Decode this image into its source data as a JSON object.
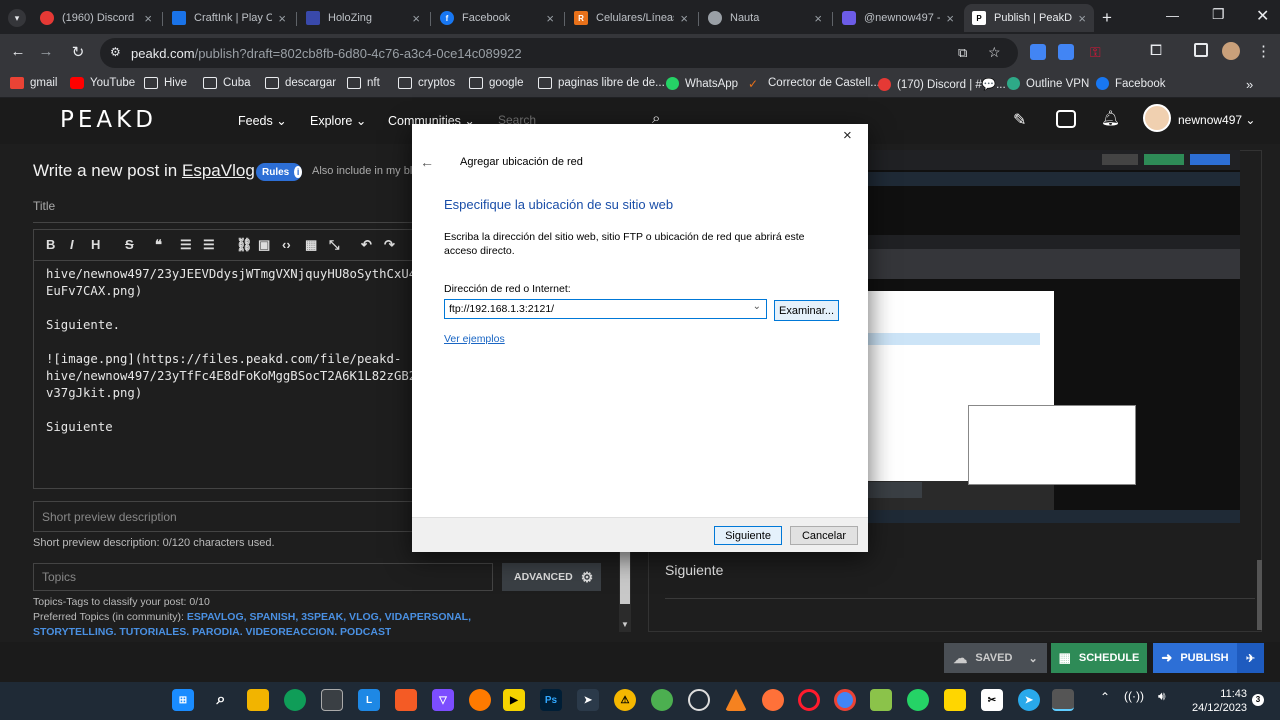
{
  "browser": {
    "tabs": [
      {
        "title": "(1960) Discord |",
        "icon": "discord-icon",
        "color": "#e53935",
        "badge": "1k+"
      },
      {
        "title": "CraftInk | Play Cr",
        "icon": "craftink-icon",
        "color": "#1a73e8"
      },
      {
        "title": "HoloZing",
        "icon": "holozing-icon",
        "color": "#3949ab"
      },
      {
        "title": "Facebook",
        "icon": "facebook-icon",
        "color": "#1877f2"
      },
      {
        "title": "Celulares/Líneas",
        "icon": "store-icon",
        "color": "#e8711a"
      },
      {
        "title": "Nauta",
        "icon": "globe-icon",
        "color": "#9aa0a6"
      },
      {
        "title": "@newnow497 -",
        "icon": "shield-icon",
        "color": "#6c5ce7"
      },
      {
        "title": "Publish | PeakD",
        "icon": "peakd-icon",
        "color": "#ffffff"
      }
    ],
    "url_main": "peakd.com",
    "url_rest": "/publish?draft=802cb8fb-6d80-4c76-a3c4-0ce14c089922",
    "bookmarks": [
      {
        "label": "gmail",
        "icon": "gmail-icon"
      },
      {
        "label": "YouTube",
        "icon": "youtube-icon"
      },
      {
        "label": "Hive",
        "icon": "folder-icon"
      },
      {
        "label": "Cuba",
        "icon": "folder-icon"
      },
      {
        "label": "descargar",
        "icon": "folder-icon"
      },
      {
        "label": "nft",
        "icon": "folder-icon"
      },
      {
        "label": "cryptos",
        "icon": "folder-icon"
      },
      {
        "label": "google",
        "icon": "folder-icon"
      },
      {
        "label": "paginas libre de de...",
        "icon": "folder-icon"
      },
      {
        "label": "WhatsApp",
        "icon": "whatsapp-icon"
      },
      {
        "label": "Corrector de Castell...",
        "icon": "pencil-icon"
      },
      {
        "label": "(170) Discord | #💬...",
        "icon": "discord-icon"
      },
      {
        "label": "Outline VPN",
        "icon": "vpn-icon"
      },
      {
        "label": "Facebook",
        "icon": "facebook-icon"
      }
    ]
  },
  "peakd": {
    "logo": "PEAKD",
    "nav": [
      "Feeds",
      "Explore",
      "Communities"
    ],
    "search_placeholder": "Search",
    "username": "newnow497"
  },
  "editor": {
    "heading_prefix": "Write a new post in",
    "community": "EspaVlog",
    "rules_label": "Rules",
    "also_include": "Also include in my blog",
    "title_placeholder": "Title",
    "body_lines": [
      "hive/newnow497/23yJEEVDdysjWTmgVXNjquyHU8oSythCxU4LQ",
      "EuFv7CAX.png)",
      "",
      "Siguiente.",
      "",
      "![image.png](https://files.peakd.com/file/peakd-",
      "hive/newnow497/23yTfFc4E8dFoKoMggBSocT2A6K1L82zGB25z",
      "v37gJkit.png)",
      "",
      "Siguiente"
    ],
    "short_desc_placeholder": "Short preview description",
    "short_desc_count": "Short preview description: 0/120 characters used.",
    "topics_placeholder": "Topics",
    "advanced_label": "ADVANCED",
    "topics_count": "Topics-Tags to classify your post: 0/10",
    "preferred_label": "Preferred Topics (in community):",
    "preferred_topics": "ESPAVLOG, SPANISH, 3SPEAK, VLOG, VIDAPERSONAL,",
    "preferred_topics_2": "STORYTELLING, TUTORIALES, PARODIA, VIDEOREACCION, PODCAST"
  },
  "preview": {
    "text": "Siguiente"
  },
  "actions": {
    "saved": "SAVED",
    "schedule": "SCHEDULE",
    "publish": "PUBLISH"
  },
  "dialog": {
    "header": "Agregar ubicación de red",
    "heading": "Especifique la ubicación de su sitio web",
    "description": "Escriba la dirección del sitio web, sitio FTP o ubicación de red que abrirá este acceso directo.",
    "field_label": "Dirección de red o Internet:",
    "field_value": "ftp://192.168.1.3:2121/",
    "browse": "Examinar...",
    "examples": "Ver ejemplos",
    "next": "Siguiente",
    "cancel": "Cancelar"
  },
  "taskbar": {
    "time": "11:43",
    "date": "24/12/2023",
    "notif_count": "3"
  },
  "colors": {
    "peakd_red": "#e31337",
    "schedule_green": "#2e8b57",
    "publish_blue": "#2d6fd6",
    "link_blue": "#1a66c4"
  }
}
